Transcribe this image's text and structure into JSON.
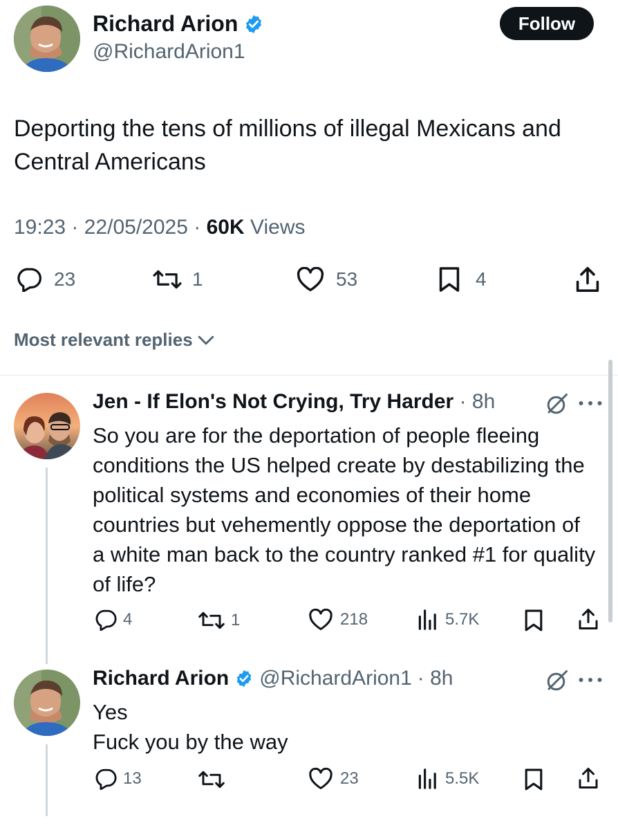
{
  "tweet": {
    "author": {
      "name": "Richard Arion",
      "handle": "@RichardArion1",
      "verified": true
    },
    "follow_label": "Follow",
    "text": "Deporting the tens of millions of illegal Mexicans and Central Americans",
    "time": "19:23",
    "date": "22/05/2025",
    "sep": "·",
    "views_count": "60K",
    "views_label": "Views",
    "stats": {
      "replies": "23",
      "reposts": "1",
      "likes": "53",
      "bookmarks": "4"
    }
  },
  "replies_filter": {
    "label": "Most relevant replies"
  },
  "replies": [
    {
      "name": "Jen - If Elon's Not Crying, Try Harder",
      "meta": "· 8h",
      "text": "So you are for the deportation of people fleeing conditions the US helped create by destabilizing the political systems and economies of their home countries but vehemently oppose the deportation of a white man back to the country ranked #1 for quality of life?",
      "stats": {
        "replies": "4",
        "reposts": "1",
        "likes": "218",
        "views": "5.7K"
      }
    },
    {
      "name": "Richard Arion",
      "handle": "@RichardArion1",
      "meta": "· 8h",
      "text_line1": "Yes",
      "text_line2": "Fuck you by the way",
      "stats": {
        "replies": "13",
        "reposts": "",
        "likes": "23",
        "views": "5.5K"
      }
    }
  ],
  "colors": {
    "accent": "#1d9bf0",
    "text": "#0f1419",
    "muted": "#536471",
    "divider": "#eff3f4"
  }
}
